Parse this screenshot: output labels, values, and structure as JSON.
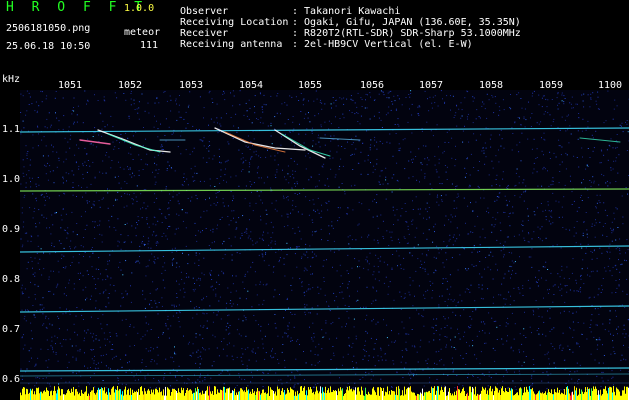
{
  "header": {
    "app_title": "H R O F F T",
    "app_version": "1.0.0",
    "file_name": "2506181050.png",
    "timestamp": "25.06.18 10:50",
    "meteor_label": "meteor",
    "meteor_count": "111"
  },
  "info": [
    {
      "label": "Observer",
      "value": ": Takanori Kawachi"
    },
    {
      "label": "Receiving Location",
      "value": ": Ogaki, Gifu, JAPAN (136.60E, 35.35N)"
    },
    {
      "label": "Receiver",
      "value": ": R820T2(RTL-SDR) SDR-Sharp 53.1000MHz"
    },
    {
      "label": "Receiving antenna",
      "value": ": 2el-HB9CV Vertical (el. E-W)"
    }
  ],
  "axis": {
    "y_unit": "kHz",
    "x_ticks": [
      "1051",
      "1052",
      "1053",
      "1054",
      "1055",
      "1056",
      "1057",
      "1058",
      "1059",
      "1100"
    ],
    "y_ticks": [
      "1.1",
      "1.0",
      "0.9",
      "0.8",
      "0.7",
      "0.6"
    ]
  },
  "colors": {
    "background": "#000000",
    "noise": "#1a2a8a",
    "signal": "#40e0ff",
    "meteor": "#ffffff",
    "bottom_bar": "#ffff00"
  }
}
